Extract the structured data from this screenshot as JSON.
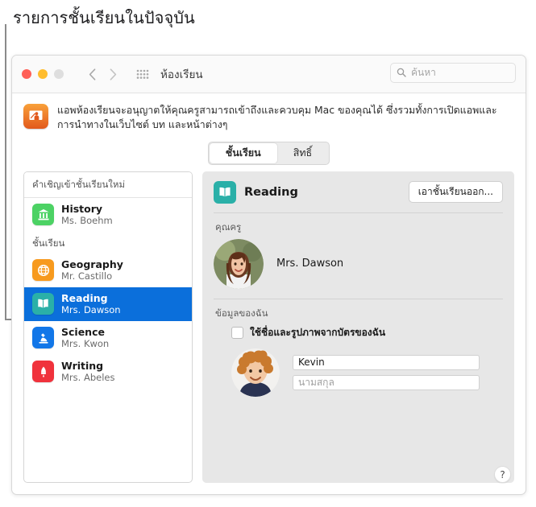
{
  "annotation": {
    "title": "รายการชั้นเรียนในปัจจุบัน"
  },
  "toolbar": {
    "window_title": "ห้องเรียน",
    "back_icon": "chevron-left-icon",
    "forward_icon": "chevron-right-icon",
    "grid_icon": "grid-dots-icon",
    "search_placeholder": "ค้นหา",
    "search_icon": "search-icon",
    "close_color": "#ff6058",
    "minimize_color": "#ffbd2e",
    "zoom_color": "#dedede"
  },
  "description": {
    "app_icon": "classroom-app-icon",
    "text": "แอพห้องเรียนจะอนุญาตให้คุณครูสามารถเข้าถึงและควบคุม Mac ของคุณได้ ซึ่งรวมทั้งการเปิดแอพและการนำทางในเว็บไซต์ บท และหน้าต่างๆ"
  },
  "tabs": [
    {
      "label": "ชั้นเรียน",
      "selected": true
    },
    {
      "label": "สิทธิ์",
      "selected": false
    }
  ],
  "sidebar": {
    "invite_header": "คำเชิญเข้าชั้นเรียนใหม่",
    "classes_header": "ชั้นเรียน",
    "invites": [
      {
        "name": "History",
        "teacher": "Ms. Boehm",
        "icon": "bank-building-icon",
        "color": "#4cd264",
        "selected": false
      }
    ],
    "classes": [
      {
        "name": "Geography",
        "teacher": "Mr. Castillo",
        "icon": "globe-icon",
        "color": "#f79a1e",
        "selected": false
      },
      {
        "name": "Reading",
        "teacher": "Mrs. Dawson",
        "icon": "open-book-icon",
        "color": "#2ab0a8",
        "selected": true
      },
      {
        "name": "Science",
        "teacher": "Mrs. Kwon",
        "icon": "microscope-icon",
        "color": "#1277e8",
        "selected": false
      },
      {
        "name": "Writing",
        "teacher": "Mrs. Abeles",
        "icon": "fountain-pen-icon",
        "color": "#f0323c",
        "selected": false
      }
    ],
    "selection_color": "#0b6fdb"
  },
  "detail": {
    "class_name": "Reading",
    "class_icon": "open-book-icon",
    "class_icon_color": "#2ab0a8",
    "remove_button": "เอาชั้นเรียนออก...",
    "teacher_label": "คุณครู",
    "teacher_name": "Mrs. Dawson",
    "teacher_avatar": "teacher-photo",
    "my_info_label": "ข้อมูลของฉัน",
    "use_card_checkbox_label": "ใช้ชื่อและรูปภาพจากบัตรของฉัน",
    "use_card_checked": false,
    "student_avatar": "student-photo",
    "first_name_value": "Kevin",
    "last_name_placeholder": "นามสกุล"
  },
  "help": {
    "label": "?"
  }
}
